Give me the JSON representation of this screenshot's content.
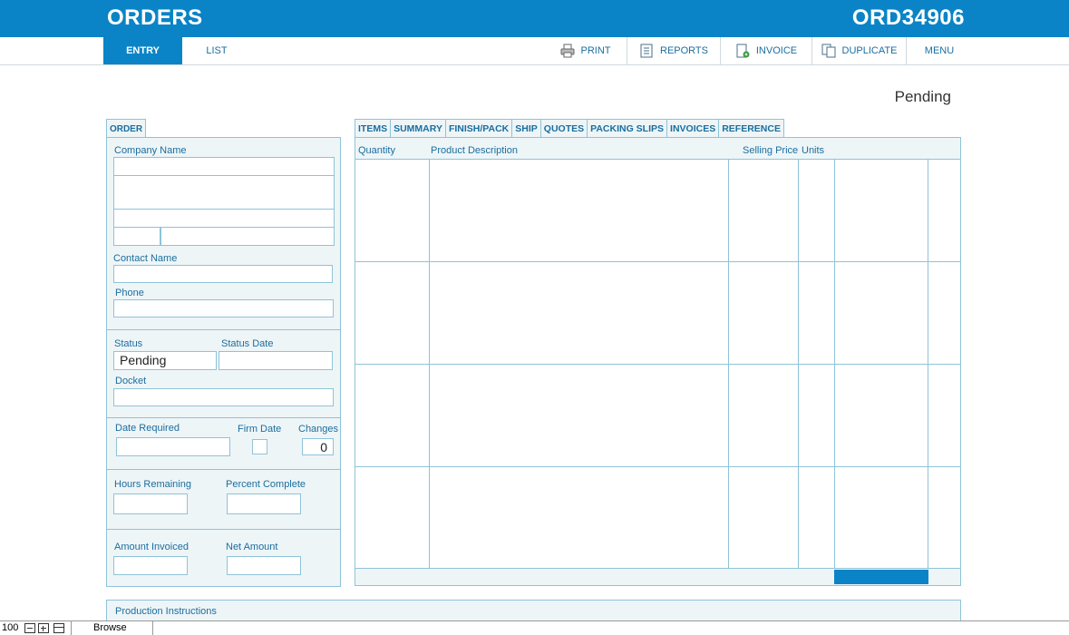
{
  "header": {
    "title": "ORDERS",
    "order_id": "ORD34906"
  },
  "nav": {
    "tabs": [
      {
        "label": "ENTRY",
        "active": true
      },
      {
        "label": "LIST",
        "active": false
      }
    ],
    "buttons": [
      {
        "label": "PRINT",
        "icon": "printer-icon"
      },
      {
        "label": "REPORTS",
        "icon": "reports-icon"
      },
      {
        "label": "INVOICE",
        "icon": "invoice-icon"
      },
      {
        "label": "DUPLICATE",
        "icon": "duplicate-icon"
      },
      {
        "label": "MENU"
      }
    ]
  },
  "status_heading": "Pending",
  "order_panel": {
    "tab_label": "ORDER",
    "company_name_label": "Company Name",
    "contact_name_label": "Contact Name",
    "phone_label": "Phone",
    "status_label": "Status",
    "status_value": "Pending",
    "status_date_label": "Status Date",
    "docket_label": "Docket",
    "date_required_label": "Date Required",
    "firm_date_label": "Firm Date",
    "changes_label": "Changes",
    "changes_value": "0",
    "hours_remaining_label": "Hours Remaining",
    "percent_complete_label": "Percent Complete",
    "amount_invoiced_label": "Amount Invoiced",
    "net_amount_label": "Net Amount"
  },
  "items_panel": {
    "tabs": [
      "ITEMS",
      "SUMMARY",
      "FINISH/PACK",
      "SHIP",
      "QUOTES",
      "PACKING SLIPS",
      "INVOICES",
      "REFERENCE"
    ],
    "columns": [
      "Quantity",
      "Product Description",
      "Selling Price",
      "Units"
    ]
  },
  "production": {
    "label": "Production Instructions"
  },
  "statusbar": {
    "zoom": "100",
    "mode": "Browse"
  },
  "colors": {
    "accent": "#0a84c6",
    "panel_bg": "#eef5f7",
    "border": "#8fc3d9",
    "text": "#1a6e9f"
  }
}
